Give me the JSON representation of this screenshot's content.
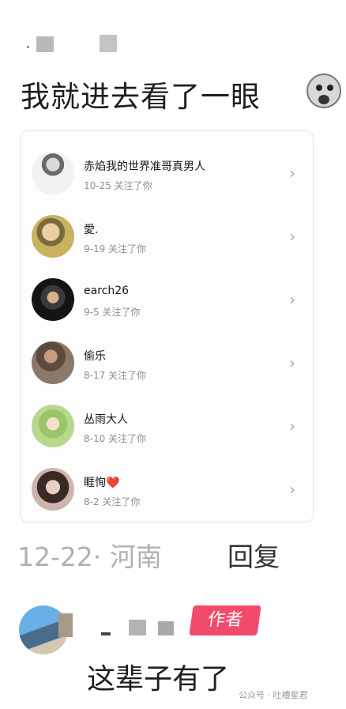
{
  "comment": {
    "text": "我就进去看了一眼",
    "emoji": "shocked-face-emoji"
  },
  "follow_list": [
    {
      "name": "赤焰我的世界准哥真男人",
      "subtitle": "10-25 关注了你"
    },
    {
      "name": "愛.",
      "subtitle": "9-19 关注了你"
    },
    {
      "name": "earch26",
      "subtitle": "9-5 关注了你"
    },
    {
      "name": "偷乐",
      "subtitle": "8-17 关注了你"
    },
    {
      "name": "丛雨大人",
      "subtitle": "8-10 关注了你"
    },
    {
      "name": "睚恂",
      "subtitle": "8-2 关注了你",
      "emoji": "❤️"
    }
  ],
  "comment_meta": {
    "date_location": "12-22· 河南",
    "reply_label": "回复"
  },
  "author_reply": {
    "badge": "作者",
    "text": "这辈子有了"
  },
  "watermark": "公众号 · 吐槽星君",
  "colors": {
    "badge": "#f24a6b",
    "heart": "#e53935"
  }
}
